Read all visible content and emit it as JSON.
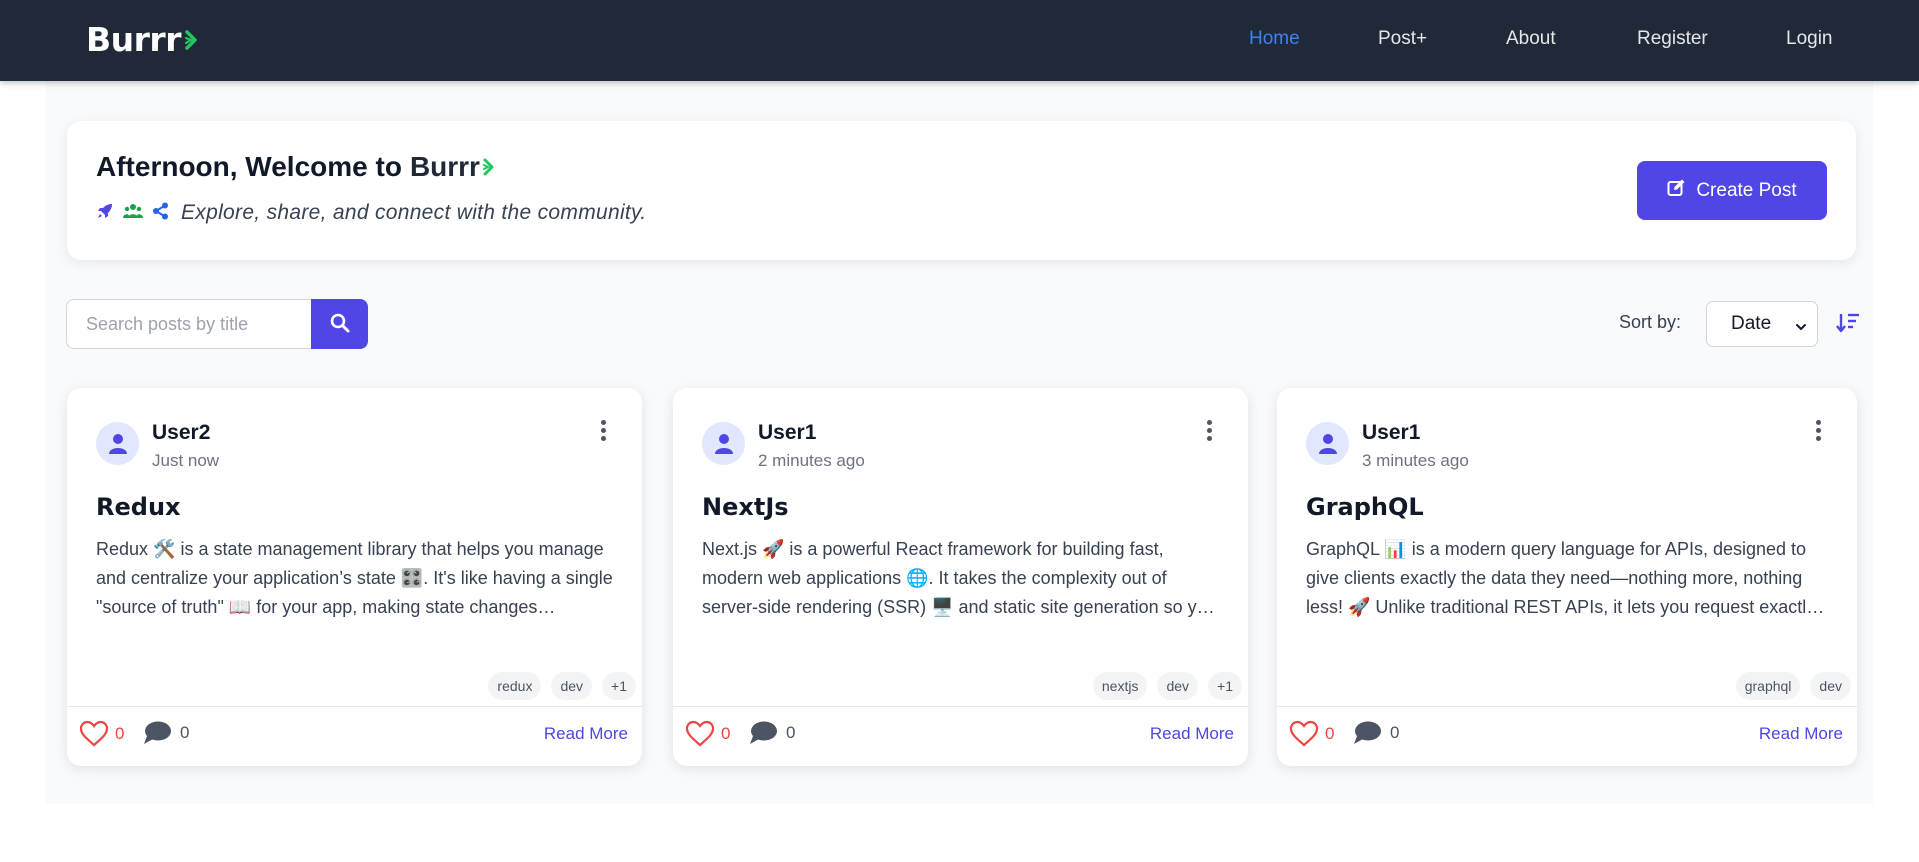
{
  "nav": {
    "brand": "Burrr",
    "links": [
      {
        "label": "Home",
        "active": true
      },
      {
        "label": "Post+",
        "active": false
      },
      {
        "label": "About",
        "active": false
      },
      {
        "label": "Register",
        "active": false
      },
      {
        "label": "Login",
        "active": false
      }
    ]
  },
  "welcome": {
    "greeting": "Afternoon, Welcome to",
    "brand": "Burrr",
    "tagline": "Explore, share, and connect with the community.",
    "icons": [
      "rocket-icon",
      "users-icon",
      "share-icon"
    ],
    "create_button": "Create Post"
  },
  "search": {
    "placeholder": "Search posts by title",
    "value": ""
  },
  "sort": {
    "label": "Sort by:",
    "selected": "Date"
  },
  "posts": [
    {
      "author": "User2",
      "time": "Just now",
      "title": "Redux",
      "excerpt": "Redux 🛠️ is a state management library that helps you manage and centralize your application’s state 🎛️. It's like having a single \"source of truth\" 📖 for your app, making state changes predictable and easier to debug.",
      "tags": [
        "redux",
        "dev",
        "+1"
      ],
      "likes": "0",
      "comments": "0",
      "read_more": "Read More"
    },
    {
      "author": "User1",
      "time": "2 minutes ago",
      "title": "NextJs",
      "excerpt": "Next.js 🚀 is a powerful React framework for building fast, modern web applications 🌐. It takes the complexity out of server-side rendering (SSR) 🖥️ and static site generation so you can focus on building.",
      "tags": [
        "nextjs",
        "dev",
        "+1"
      ],
      "likes": "0",
      "comments": "0",
      "read_more": "Read More"
    },
    {
      "author": "User1",
      "time": "3 minutes ago",
      "title": "GraphQL",
      "excerpt": "GraphQL 📊 is a modern query language for APIs, designed to give clients exactly the data they need—nothing more, nothing less! 🚀 Unlike traditional REST APIs, it lets you request exactly what you want.",
      "tags": [
        "graphql",
        "dev"
      ],
      "likes": "0",
      "comments": "0",
      "read_more": "Read More"
    }
  ],
  "colors": {
    "navbar": "#1f2937",
    "accent": "#4f46e5",
    "nav_active": "#3b82f6",
    "brand_mark": "#22c55e",
    "like": "#ef4444"
  }
}
